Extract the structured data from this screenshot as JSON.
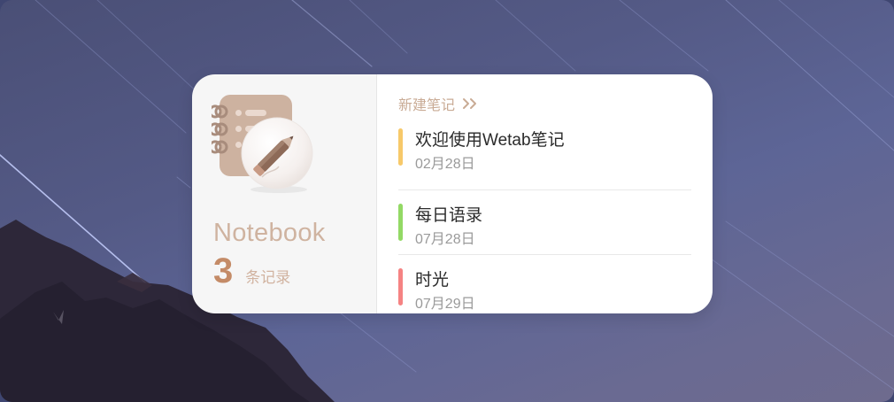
{
  "widget": {
    "app_name": "Notebook",
    "record_count": "3",
    "record_label": "条记录",
    "new_note_label": "新建笔记",
    "new_note_icon": "double-chevron-right-icon",
    "notebook_icon": "notebook-pencil-icon",
    "notes": [
      {
        "title": "欢迎使用Wetab笔记",
        "date": "02月28日",
        "color": "#f7c96a"
      },
      {
        "title": "每日语录",
        "date": "07月28日",
        "color": "#93d965"
      },
      {
        "title": "时光",
        "date": "07月29日",
        "color": "#f58383"
      }
    ]
  },
  "colors": {
    "accent": "#c48b67",
    "accent_light": "#cfb3a0",
    "panel_left": "#f6f6f6",
    "panel_right": "#ffffff"
  }
}
